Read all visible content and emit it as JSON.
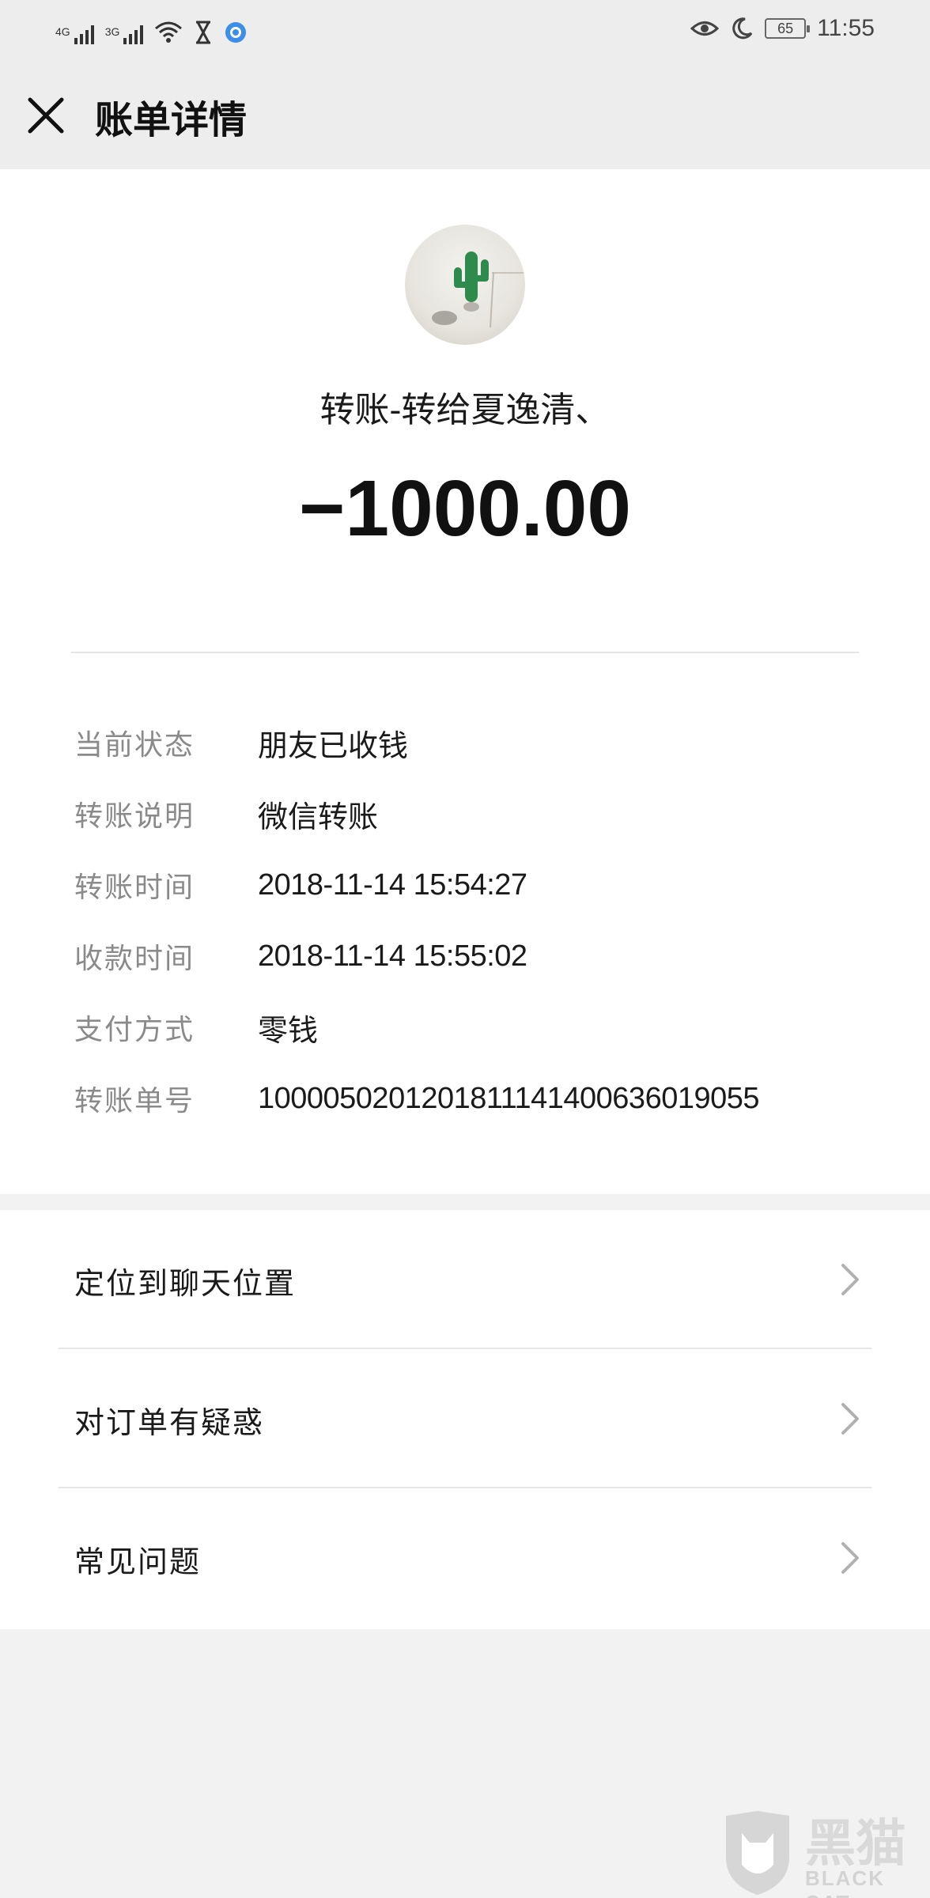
{
  "status_bar": {
    "signal_1_label": "4G",
    "signal_2_label": "3G",
    "time": "11:55",
    "battery_level": "65",
    "icons": [
      "signal-icon",
      "signal-icon",
      "wifi-icon",
      "hourglass-icon",
      "browser-icon",
      "eye-icon",
      "moon-icon",
      "battery-icon"
    ]
  },
  "header": {
    "title": "账单详情",
    "close_icon": "close-icon"
  },
  "transfer": {
    "recipient": "转账-转给夏逸清、",
    "amount": "−1000.00"
  },
  "details": [
    {
      "label": "当前状态",
      "value": "朋友已收钱"
    },
    {
      "label": "转账说明",
      "value": "微信转账"
    },
    {
      "label": "转账时间",
      "value": "2018-11-14 15:54:27"
    },
    {
      "label": "收款时间",
      "value": "2018-11-14 15:55:02"
    },
    {
      "label": "支付方式",
      "value": "零钱"
    },
    {
      "label": "转账单号",
      "value": "1000050201201811141400636019055"
    }
  ],
  "actions": [
    {
      "label": "定位到聊天位置",
      "icon": "chevron-right-icon"
    },
    {
      "label": "对订单有疑惑",
      "icon": "chevron-right-icon"
    },
    {
      "label": "常见问题",
      "icon": "chevron-right-icon"
    }
  ],
  "watermark": {
    "text_cn": "黑猫",
    "text_en": "BLACK CAT"
  },
  "colors": {
    "page_bg": "#f2f2f2",
    "card_bg": "#ffffff",
    "label_gray": "#8a8a8a",
    "text_dark": "#1a1a1a"
  }
}
